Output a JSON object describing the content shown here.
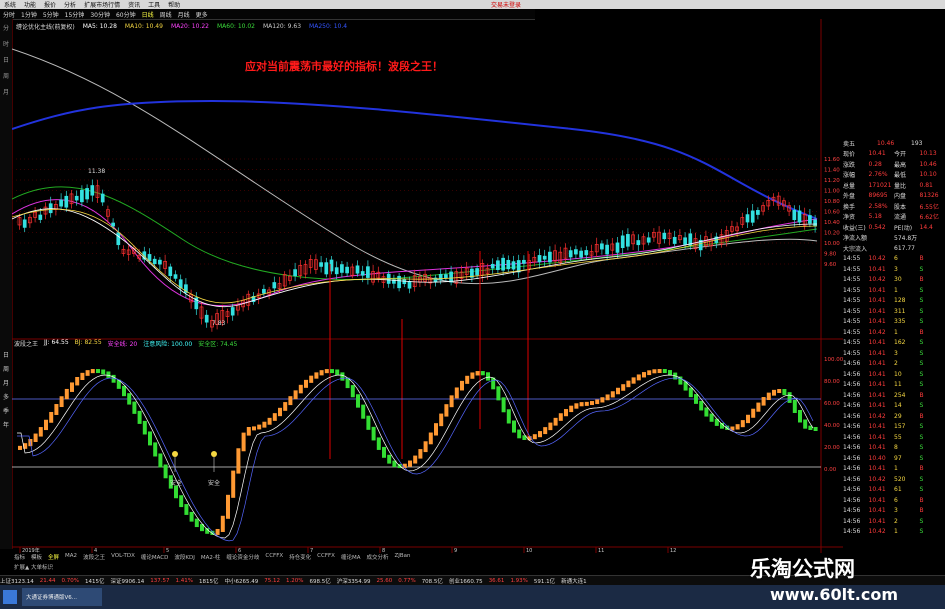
{
  "menubar": {
    "items": [
      "系统",
      "功能",
      "报价",
      "分析",
      "扩展市场行情",
      "资讯",
      "工具",
      "帮助"
    ],
    "brand": "交易未登录"
  },
  "toolbar": {
    "items": [
      "分时",
      "1分钟",
      "5分钟",
      "15分钟",
      "30分钟",
      "60分钟",
      "日线",
      "周线",
      "月线",
      "更多"
    ],
    "selected": "日线"
  },
  "left_tabs": [
    "分",
    "时",
    "日",
    "周",
    "月",
    "多",
    "季",
    "年"
  ],
  "main": {
    "title": "缠论优化主线(前复权)",
    "ma": [
      {
        "label": "MA5: 10.28",
        "color": "#ffffff"
      },
      {
        "label": "MA10: 10.49",
        "color": "#f5d742"
      },
      {
        "label": "MA20: 10.22",
        "color": "#ff44ff"
      },
      {
        "label": "MA60: 10.02",
        "color": "#3bdc3b"
      },
      {
        "label": "MA120: 9.63",
        "color": "#cccccc"
      },
      {
        "label": "MA250: 10.4",
        "color": "#3355ff"
      }
    ],
    "headline": "应对当前震荡市最好的指标！波段之王！",
    "price_high": "11.38",
    "price_low": "7.83",
    "axis_labels": [
      "11.60",
      "11.40",
      "11.20",
      "11.00",
      "10.80",
      "10.60",
      "10.40",
      "10.20",
      "10.00",
      "9.80",
      "9.60"
    ]
  },
  "indicator": {
    "name": "波段之王",
    "vals": [
      {
        "label": "JJ: 64.55",
        "color": "#ffffff"
      },
      {
        "label": "BJ: 82.55",
        "color": "#f5d742"
      },
      {
        "label": "安全线: 20",
        "color": "#ff44ff"
      },
      {
        "label": "注意风险: 100.00",
        "color": "#4ff"
      },
      {
        "label": "安全区: 74.45",
        "color": "#3bdc3b"
      }
    ],
    "markers": [
      "安全",
      "安全"
    ],
    "axis_labels": [
      "100.00",
      "80.00",
      "60.00",
      "40.00",
      "20.00",
      "0.00"
    ]
  },
  "date_ticks": [
    "2019年",
    "4",
    "5",
    "6",
    "7",
    "8",
    "9",
    "10",
    "11",
    "12"
  ],
  "bottom_tabs": [
    "指标",
    "模板",
    "全屏",
    "MA2",
    "波段之王",
    "VOL-TDX",
    "缠论MACD",
    "波段KDJ",
    "MA2-柱",
    "缠论资金分歧",
    "CCFFX",
    "持仓变化",
    "CCFFX",
    "缠论MA",
    "成交分析",
    "ZJBan"
  ],
  "bottom_sub": "扩展▲  大单标识",
  "quote_panel": {
    "rows": [
      [
        "卖五",
        "10.46",
        "193"
      ],
      [
        "现价",
        "10.41",
        "今开",
        "10.13"
      ],
      [
        "涨跌",
        "0.28",
        "最高",
        "10.46"
      ],
      [
        "涨幅",
        "2.76%",
        "最低",
        "10.10"
      ],
      [
        "总量",
        "171021",
        "量比",
        "0.81"
      ],
      [
        "外盘",
        "89695",
        "内盘",
        "81326"
      ],
      [
        "换手",
        "2.58%",
        "股本",
        "6.55亿"
      ],
      [
        "净资",
        "5.18",
        "流通",
        "6.62亿"
      ],
      [
        "收益(三)",
        "0.542",
        "PE(动)",
        "14.4"
      ],
      [
        "净流入额",
        "",
        "574.8万",
        ""
      ],
      [
        "大宗流入",
        "",
        "617.77",
        ""
      ]
    ],
    "ticks": [
      [
        "14:55",
        "10.42",
        "6",
        "B"
      ],
      [
        "14:55",
        "10.41",
        "3",
        "S"
      ],
      [
        "14:55",
        "10.42",
        "30",
        "B"
      ],
      [
        "14:55",
        "10.41",
        "1",
        "S"
      ],
      [
        "14:55",
        "10.41",
        "128",
        "S"
      ],
      [
        "14:55",
        "10.41",
        "311",
        "S"
      ],
      [
        "14:55",
        "10.41",
        "335",
        "S"
      ],
      [
        "14:55",
        "10.42",
        "1",
        "B"
      ],
      [
        "14:55",
        "10.41",
        "162",
        "S"
      ],
      [
        "14:55",
        "10.41",
        "3",
        "S"
      ],
      [
        "14:56",
        "10.41",
        "2",
        "S"
      ],
      [
        "14:56",
        "10.41",
        "10",
        "S"
      ],
      [
        "14:56",
        "10.41",
        "11",
        "S"
      ],
      [
        "14:56",
        "10.41",
        "254",
        "B"
      ],
      [
        "14:56",
        "10.41",
        "14",
        "S"
      ],
      [
        "14:56",
        "10.42",
        "29",
        "B"
      ],
      [
        "14:56",
        "10.41",
        "157",
        "S"
      ],
      [
        "14:56",
        "10.41",
        "55",
        "S"
      ],
      [
        "14:56",
        "10.41",
        "8",
        "S"
      ],
      [
        "14:56",
        "10.40",
        "97",
        "S"
      ],
      [
        "14:56",
        "10.41",
        "1",
        "B"
      ],
      [
        "14:56",
        "10.42",
        "520",
        "S"
      ],
      [
        "14:56",
        "10.41",
        "61",
        "S"
      ],
      [
        "14:56",
        "10.41",
        "6",
        "B"
      ],
      [
        "14:56",
        "10.41",
        "3",
        "B"
      ],
      [
        "14:56",
        "10.41",
        "2",
        "S"
      ],
      [
        "14:56",
        "10.42",
        "1",
        "S"
      ]
    ]
  },
  "statusbar": {
    "items": [
      "上证3123.14",
      "21.44",
      "0.70%",
      "1415亿",
      "深证9906.14",
      "137.57",
      "1.41%",
      "1815亿",
      "中小6265.49",
      "75.12",
      "1.20%",
      "698.5亿",
      "沪深3354.99",
      "25.60",
      "0.77%",
      "708.5亿",
      "创业1660.75",
      "36.61",
      "1.93%",
      "591.1亿",
      "新通大连1"
    ]
  },
  "taskbar": {
    "app": "大通证券博通版V6..."
  },
  "watermark": {
    "title": "乐淘公式网",
    "url": "www.60lt.com"
  }
}
